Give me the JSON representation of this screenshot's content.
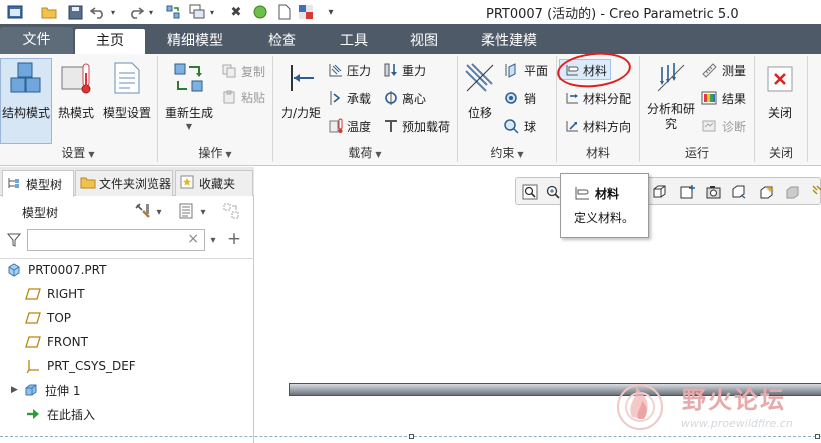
{
  "app": {
    "title": "PRT0007 (活动的) - Creo Parametric 5.0"
  },
  "quick_access": {
    "icons": [
      "app-window-icon",
      "open-folder-icon",
      "save-icon",
      "undo-icon",
      "redo-icon",
      "regenerate-icon",
      "windows-icon",
      "close-window-icon",
      "sphere-icon",
      "new-file-icon",
      "color-swatch-icon",
      "customize-icon"
    ]
  },
  "tabs": [
    {
      "label": "文件"
    },
    {
      "label": "主页"
    },
    {
      "label": "精细模型"
    },
    {
      "label": "检查"
    },
    {
      "label": "工具"
    },
    {
      "label": "视图"
    },
    {
      "label": "柔性建模"
    }
  ],
  "ribbon": {
    "setup": {
      "label": "设置",
      "structure_mode": "结构模式",
      "thermal_mode": "热模式",
      "model_setup": "模型设置"
    },
    "operations": {
      "label": "操作",
      "regenerate": "重新生成",
      "copy": "复制",
      "paste": "粘贴"
    },
    "loads": {
      "label": "载荷",
      "force_moment": "力/力矩",
      "pressure": "压力",
      "gravity": "重力",
      "bearing": "承载",
      "centrifugal": "离心",
      "temperature": "温度",
      "preload": "预加载荷"
    },
    "constraints": {
      "label": "约束",
      "displacement": "位移",
      "plane": "平面",
      "pin": "销",
      "ball": "球"
    },
    "materials": {
      "label": "材料",
      "material": "材料",
      "material_assignment": "材料分配",
      "material_orientation": "材料方向"
    },
    "run": {
      "label": "运行",
      "analyses_line1": "分析和研",
      "analyses_line2": "究",
      "measure": "测量",
      "results": "结果",
      "diagnostics": "诊断"
    },
    "close": {
      "label": "关闭",
      "close": "关闭"
    }
  },
  "left_panel": {
    "tabs": [
      {
        "label": "模型树"
      },
      {
        "label": "文件夹浏览器"
      },
      {
        "label": "收藏夹"
      }
    ],
    "tree_heading": "模型树",
    "filter": {
      "value": "",
      "clear": "×"
    },
    "add_symbol": "+",
    "items": [
      {
        "label": "PRT0007.PRT",
        "icon": "part-icon"
      },
      {
        "label": "RIGHT",
        "icon": "datum-plane-icon"
      },
      {
        "label": "TOP",
        "icon": "datum-plane-icon"
      },
      {
        "label": "FRONT",
        "icon": "datum-plane-icon"
      },
      {
        "label": "PRT_CSYS_DEF",
        "icon": "coordinate-system-icon"
      },
      {
        "label": "拉伸 1",
        "icon": "extrude-icon"
      },
      {
        "label": "在此插入",
        "icon": "insert-here-icon"
      }
    ]
  },
  "tooltip": {
    "title": "材料",
    "description": "定义材料。"
  },
  "watermark": {
    "title": "野火论坛",
    "url": "www.proewildfire.cn"
  },
  "colors": {
    "tab_bar": "#4e5a67",
    "ribbon_bg": "#f7f7f7",
    "highlight": "#dcebfb",
    "annotation_red": "#e01e1e",
    "watermark_red": "#e7a9a9"
  }
}
